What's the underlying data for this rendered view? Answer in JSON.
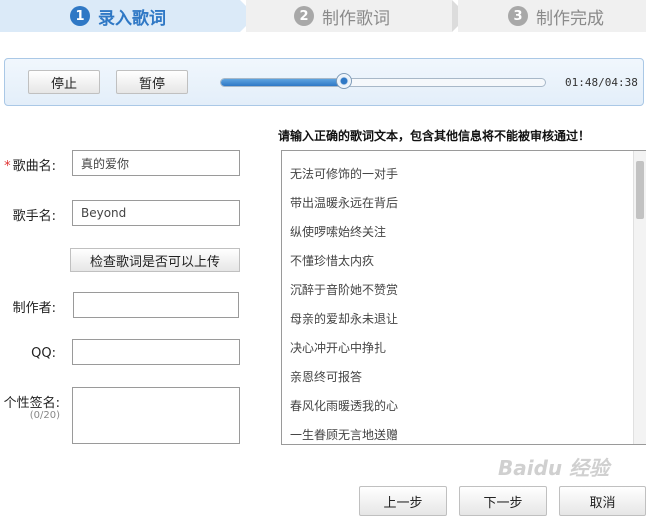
{
  "steps": [
    {
      "num": "1",
      "label": "录入歌词"
    },
    {
      "num": "2",
      "label": "制作歌词"
    },
    {
      "num": "3",
      "label": "制作完成"
    }
  ],
  "player": {
    "stop_label": "停止",
    "pause_label": "暂停",
    "progress": 0.38,
    "time": "01:48/04:38"
  },
  "form": {
    "song_label": "歌曲名:",
    "song_value": "真的爱你",
    "singer_label": "歌手名:",
    "singer_value": "Beyond",
    "check_label": "检查歌词是否可以上传",
    "producer_label": "制作者:",
    "qq_label": "QQ:",
    "signature_label": "个性签名:",
    "signature_counter": "(0/20)"
  },
  "lyrics": {
    "instruction": "请输入正确的歌词文本，包含其他信息将不能被审核通过！",
    "lines": [
      "无法可修饰的一对手",
      "带出温暖永远在背后",
      "纵使啰嗦始终关注",
      "不懂珍惜太内疚",
      "沉醉于音阶她不赞赏",
      "母亲的爱却永未退让",
      "决心冲开心中挣扎",
      "亲恩终可报答",
      "春风化雨暖透我的心",
      "一生眷顾无言地送赠"
    ]
  },
  "footer": {
    "prev_label": "上一步",
    "next_label": "下一步",
    "cancel_label": "取消"
  },
  "watermark": "Baidu 经验",
  "colors": {
    "accent": "#2f78c5",
    "required": "#e03030"
  }
}
